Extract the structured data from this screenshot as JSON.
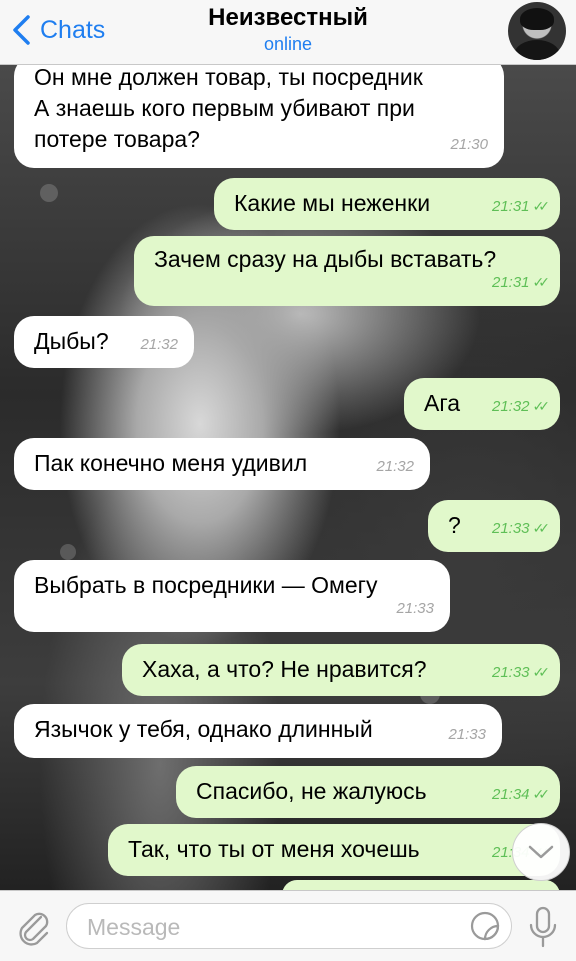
{
  "header": {
    "back_label": "Chats",
    "title": "Неизвестный",
    "status": "online"
  },
  "messages": [
    {
      "direction": "in",
      "text": "Он мне должен товар, ты посредник\nА знаешь кого первым убивают при\nпотере товара?",
      "time": "21:30"
    },
    {
      "direction": "out",
      "text": "Какие мы неженки",
      "time": "21:31",
      "read": true
    },
    {
      "direction": "out",
      "text": "Зачем сразу на дыбы вставать?",
      "time": "21:31",
      "read": true
    },
    {
      "direction": "in",
      "text": "Дыбы?",
      "time": "21:32"
    },
    {
      "direction": "out",
      "text": "Ага",
      "time": "21:32",
      "read": true
    },
    {
      "direction": "in",
      "text": "Пак конечно меня удивил",
      "time": "21:32"
    },
    {
      "direction": "out",
      "text": "?",
      "time": "21:33",
      "read": true
    },
    {
      "direction": "in",
      "text": "Выбрать в посредники — Омегу",
      "time": "21:33"
    },
    {
      "direction": "out",
      "text": "Хаха, а что? Не нравится?",
      "time": "21:33",
      "read": true
    },
    {
      "direction": "in",
      "text": "Язычок у тебя, однако длинный",
      "time": "21:33"
    },
    {
      "direction": "out",
      "text": "Спасибо, не жалуюсь",
      "time": "21:34",
      "read": true
    },
    {
      "direction": "out",
      "text": "Так, что ты от меня хочешь",
      "time": "21:34",
      "read": true
    }
  ],
  "input": {
    "placeholder": "Message"
  },
  "colors": {
    "accent": "#1f7ef0",
    "outgoing_bubble": "#e1f8cb",
    "incoming_bubble": "#ffffff",
    "read_ticks": "#5fbf57"
  },
  "icons": [
    "back-chevron-icon",
    "avatar",
    "scroll-down-icon",
    "attach-icon",
    "sticker-icon",
    "microphone-icon"
  ]
}
